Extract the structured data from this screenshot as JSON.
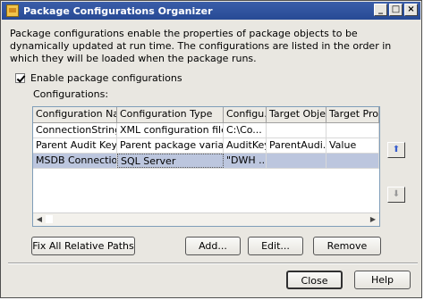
{
  "window": {
    "title": "Package Configurations Organizer"
  },
  "description": "Package configurations enable the properties of package objects to be dynamically updated at run time. The configurations are listed in the order in which they will be loaded when the package runs.",
  "enable_checkbox": {
    "label": "Enable package configurations",
    "checked": true
  },
  "configurations_label": "Configurations:",
  "table": {
    "columns": [
      "Configuration Name",
      "Configuration Type",
      "Configu...",
      "Target Object",
      "Target Prop..."
    ],
    "rows": [
      {
        "name": "ConnectionStrings",
        "type": "XML configuration file",
        "config": "C:\\Co...",
        "target_object": "",
        "target_prop": ""
      },
      {
        "name": "Parent Audit Key",
        "type": "Parent package variable",
        "config": "AuditKey",
        "target_object": "ParentAudi...",
        "target_prop": "Value"
      },
      {
        "name": "MSDB Connection",
        "type": "SQL Server",
        "config": "\"DWH ...",
        "target_object": "",
        "target_prop": ""
      }
    ],
    "selected_row": 2
  },
  "buttons": {
    "fix_paths": "Fix All Relative Paths",
    "add": "Add...",
    "edit": "Edit...",
    "remove": "Remove",
    "close": "Close",
    "help": "Help"
  },
  "icons": {
    "move_up": "up-arrow-icon",
    "move_down": "down-arrow-icon"
  }
}
